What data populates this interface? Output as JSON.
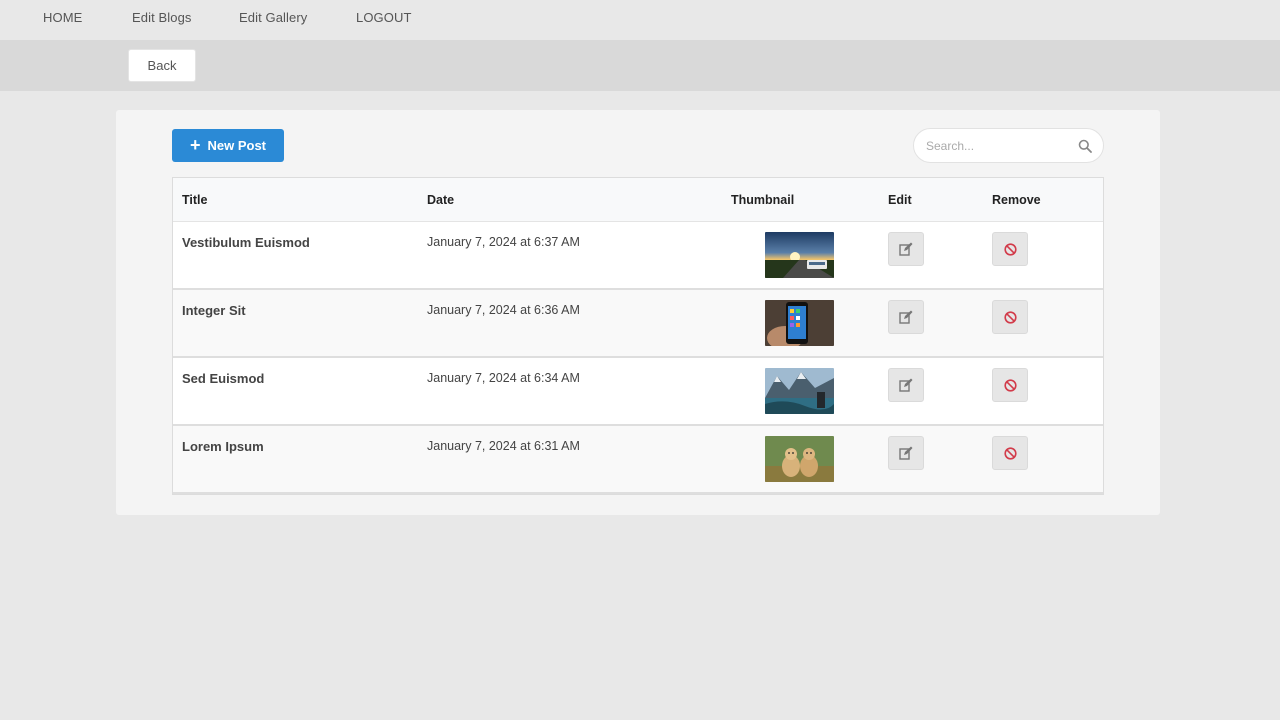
{
  "nav": {
    "items": [
      "HOME",
      "Edit Blogs",
      "Edit Gallery",
      "LOGOUT"
    ]
  },
  "back_label": "Back",
  "toolbar": {
    "new_post_label": "New Post",
    "search_placeholder": "Search..."
  },
  "table": {
    "headers": {
      "title": "Title",
      "date": "Date",
      "thumbnail": "Thumbnail",
      "edit": "Edit",
      "remove": "Remove"
    },
    "rows": [
      {
        "title": "Vestibulum Euismod",
        "date": "January 7, 2024 at 6:37 AM",
        "thumb": "road-bus-sunset"
      },
      {
        "title": "Integer Sit",
        "date": "January 7, 2024 at 6:36 AM",
        "thumb": "smartphone-in-hand"
      },
      {
        "title": "Sed Euismod",
        "date": "January 7, 2024 at 6:34 AM",
        "thumb": "mountain-lake"
      },
      {
        "title": "Lorem Ipsum",
        "date": "January 7, 2024 at 6:31 AM",
        "thumb": "two-puppies"
      }
    ]
  },
  "colors": {
    "accent": "#2b8ad6",
    "remove_icon": "#d23b4a",
    "edit_icon": "#777777"
  },
  "icons": {
    "new_post": "plus-icon",
    "search": "search-icon",
    "edit": "edit-icon",
    "remove": "ban-icon"
  }
}
